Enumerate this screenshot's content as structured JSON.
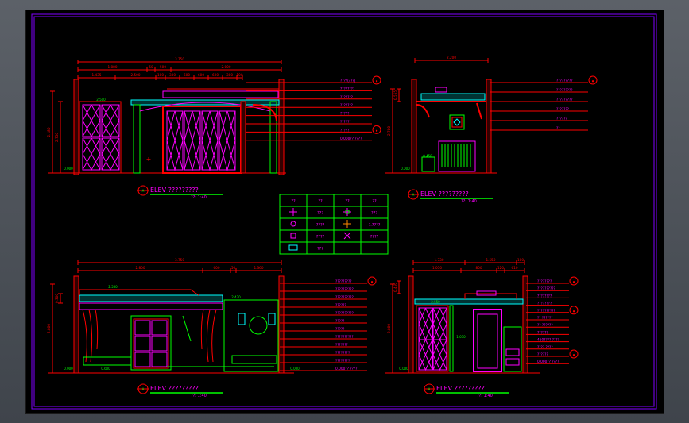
{
  "colors": {
    "background": "#000000",
    "dimension": "#ff0000",
    "wall": "#ff0000",
    "furniture": "#00ff00",
    "cabinet": "#ff00ff",
    "ceiling": "#00ffff",
    "note": "#ff00ff",
    "sheet_border": "#8000ff"
  },
  "elevations": [
    {
      "id": "A",
      "title": "ELEV  ?????????",
      "scale": "??: 1:40",
      "top_dims": [
        "3.750"
      ],
      "second_dims": [
        "1.880",
        "50",
        "500",
        "2.000"
      ],
      "third_dims": [
        "1.435",
        "2.500",
        "100",
        "330",
        "600",
        "600",
        "600",
        "300",
        "100"
      ],
      "left_dims": [
        "2.180",
        "2.750"
      ],
      "inner_labels": [
        "2.500",
        "2.120",
        "3.000",
        "0.000"
      ],
      "notes": [
        "????(???)",
        "????????",
        "???????",
        "???????",
        "?????",
        "??????",
        "?????",
        "0.000?? ????"
      ]
    },
    {
      "id": "B",
      "title": "ELEV  ?????????",
      "scale": "??: 1:40",
      "top_dims": [
        "2.200"
      ],
      "left_dims": [
        "2.700",
        "0.555"
      ],
      "inner_labels": [
        "2.500",
        "0.000",
        "0.450"
      ],
      "notes": [
        "?????????",
        "?????????",
        "?????????",
        "???????",
        "??????",
        "??"
      ]
    },
    {
      "id": "C",
      "title": "ELEV  ?????????",
      "scale": "??: 1:40",
      "top_dims": [
        "3.750"
      ],
      "second_dims": [
        "2.800",
        "600",
        "50",
        "1.360"
      ],
      "left_dims": [
        "2.800",
        "0.300"
      ],
      "inner_labels": [
        "2.550",
        "2.430",
        "0.600",
        "0.000",
        "0.000"
      ],
      "notes": [
        "?????????",
        "??????????",
        "??????????",
        "??????",
        "??????????",
        "?????",
        "?????",
        "??????????",
        "???????",
        "????????",
        "????????",
        "0.000?? ????"
      ]
    },
    {
      "id": "D",
      "title": "ELEV  ?????????",
      "scale": "??: 1:40",
      "top_dims": [
        "1.730",
        "1.550",
        "100"
      ],
      "second_dims": [
        "1.050",
        "800",
        "120",
        "610"
      ],
      "left_dims": [
        "2.800",
        "0.450"
      ],
      "inner_labels": [
        "2.550",
        "2.500",
        "1.050",
        "0.000"
      ],
      "notes": [
        "????????",
        "??????????",
        "????????",
        "????????",
        "??????????",
        "?? ??????",
        "?? ??????",
        "??????",
        "450???? ????",
        "???? ????",
        "??????",
        "0.000?? ????"
      ]
    }
  ],
  "legend": {
    "header": [
      "??",
      "??",
      "??",
      "??"
    ],
    "rows": [
      {
        "icon1": "crosshair-icon",
        "label1": "???",
        "icon2": "crosshair-target-icon",
        "label2": "???"
      },
      {
        "icon1": "circle-icon",
        "label1": "????",
        "icon2": "orange-cross-icon",
        "label2": "?.????"
      },
      {
        "icon1": "square-icon",
        "label1": "????",
        "icon2": "x-icon",
        "label2": "????"
      },
      {
        "icon1": "grille-icon",
        "label1": "???",
        "icon2": "",
        "label2": ""
      }
    ]
  }
}
